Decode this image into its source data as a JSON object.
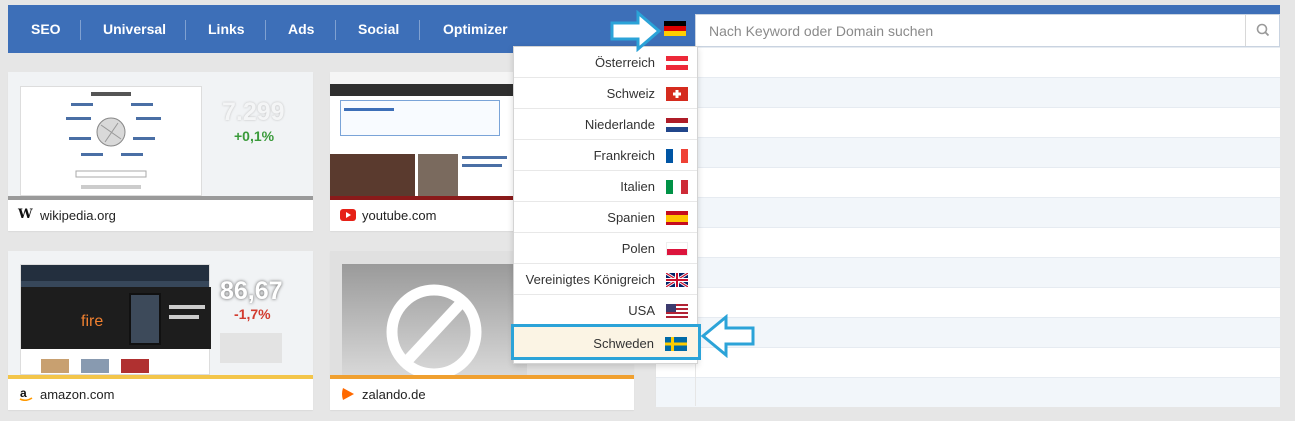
{
  "nav": {
    "items": [
      "SEO",
      "Universal",
      "Links",
      "Ads",
      "Social",
      "Optimizer"
    ]
  },
  "search": {
    "placeholder": "Nach Keyword oder Domain suchen",
    "current_country_flag": "germany-flag-icon"
  },
  "dropdown": {
    "countries": [
      {
        "label": "Österreich",
        "flag": "austria-flag-icon"
      },
      {
        "label": "Schweiz",
        "flag": "switzerland-flag-icon"
      },
      {
        "label": "Niederlande",
        "flag": "netherlands-flag-icon"
      },
      {
        "label": "Frankreich",
        "flag": "france-flag-icon"
      },
      {
        "label": "Italien",
        "flag": "italy-flag-icon"
      },
      {
        "label": "Spanien",
        "flag": "spain-flag-icon"
      },
      {
        "label": "Polen",
        "flag": "poland-flag-icon"
      },
      {
        "label": "Vereinigtes Königreich",
        "flag": "uk-flag-icon"
      },
      {
        "label": "USA",
        "flag": "usa-flag-icon"
      },
      {
        "label": "Schweden",
        "flag": "sweden-flag-icon",
        "selected": true
      }
    ]
  },
  "cards": [
    {
      "domain": "wikipedia.org",
      "value": "7.299",
      "change": "+0,1%",
      "trend": "up",
      "favicon": "wikipedia-icon"
    },
    {
      "domain": "youtube.com",
      "favicon": "youtube-icon"
    },
    {
      "domain": "amazon.com",
      "value": "86,67",
      "change": "-1,7%",
      "trend": "down",
      "favicon": "amazon-icon"
    },
    {
      "domain": "zalando.de",
      "favicon": "zalando-icon"
    }
  ],
  "colors": {
    "nav_bg": "#3d6fb8",
    "positive": "#3a9a3a",
    "negative": "#d23b2f",
    "highlight_arrow": "#2ba3d8"
  }
}
